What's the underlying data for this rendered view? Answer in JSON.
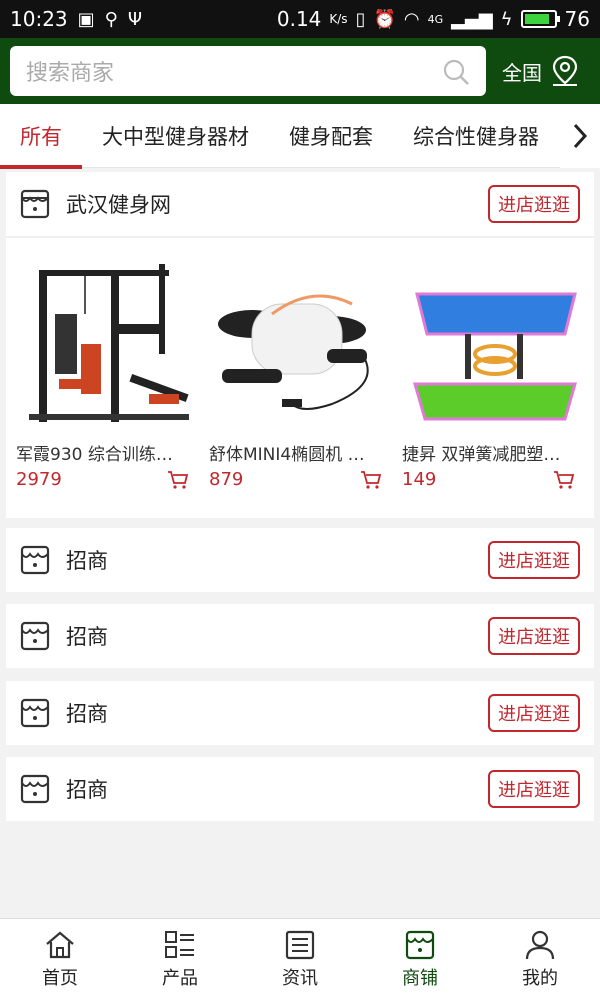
{
  "status_bar": {
    "time": "10:23",
    "speed": "0.14",
    "speed_unit": "K/s",
    "network": "4G",
    "battery": "76"
  },
  "header": {
    "search_placeholder": "搜索商家",
    "region": "全国"
  },
  "tabs": [
    {
      "label": "所有"
    },
    {
      "label": "大中型健身器材"
    },
    {
      "label": "健身配套"
    },
    {
      "label": "综合性健身器"
    }
  ],
  "stores": [
    {
      "name": "武汉健身网",
      "button": "进店逛逛",
      "products": [
        {
          "name": "军霞930 综合训练…",
          "price": "2979"
        },
        {
          "name": "舒体MINI4椭圆机 …",
          "price": "879"
        },
        {
          "name": "捷昇 双弹簧减肥塑…",
          "price": "149"
        }
      ]
    },
    {
      "name": "招商",
      "button": "进店逛逛"
    },
    {
      "name": "招商",
      "button": "进店逛逛"
    },
    {
      "name": "招商",
      "button": "进店逛逛"
    },
    {
      "name": "招商",
      "button": "进店逛逛"
    }
  ],
  "bottom_nav": [
    {
      "label": "首页",
      "icon": "home-icon"
    },
    {
      "label": "产品",
      "icon": "list-icon"
    },
    {
      "label": "资讯",
      "icon": "news-icon"
    },
    {
      "label": "商铺",
      "icon": "store-icon"
    },
    {
      "label": "我的",
      "icon": "user-icon"
    }
  ],
  "colors": {
    "brand_green": "#0f4a0e",
    "accent_red": "#c2272d"
  }
}
